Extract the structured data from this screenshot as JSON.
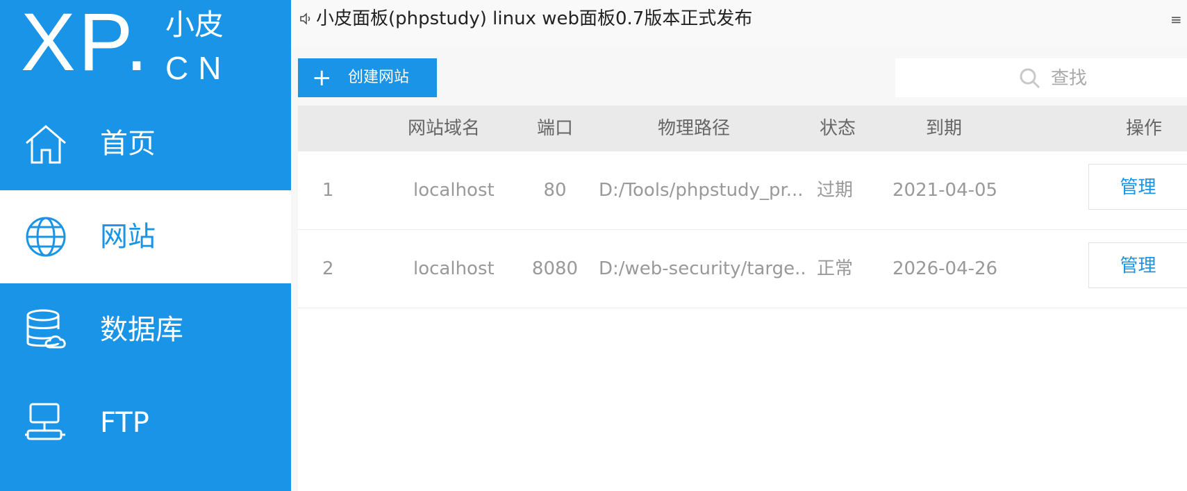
{
  "logo": {
    "main": "XP.",
    "cn_top": "小皮",
    "cn_bottom": "CN"
  },
  "sidebar": {
    "items": [
      {
        "label": "首页",
        "icon": "home-icon",
        "active": false
      },
      {
        "label": "网站",
        "icon": "globe-icon",
        "active": true
      },
      {
        "label": "数据库",
        "icon": "database-icon",
        "active": false
      },
      {
        "label": "FTP",
        "icon": "ftp-icon",
        "active": false
      }
    ]
  },
  "notice": {
    "text": "小皮面板(phpstudy) linux web面板0.7版本正式发布",
    "menu_glyph": "≡"
  },
  "toolbar": {
    "create_plus": "+",
    "create_label": "创建网站",
    "search_placeholder": "查找"
  },
  "table": {
    "headers": [
      "网站域名",
      "端口",
      "物理路径",
      "状态",
      "到期",
      "操作"
    ],
    "rows": [
      {
        "index": "1",
        "domain": "localhost",
        "port": "80",
        "path": "D:/Tools/phpstudy_pr...",
        "status": "过期",
        "expiry": "2021-04-05",
        "action": "管理"
      },
      {
        "index": "2",
        "domain": "localhost",
        "port": "8080",
        "path": "D:/web-security/targe...",
        "status": "正常",
        "expiry": "2026-04-26",
        "action": "管理"
      }
    ]
  },
  "colors": {
    "accent": "#1a94e6",
    "header_bg": "#eaeaea",
    "muted_text": "#999999"
  }
}
